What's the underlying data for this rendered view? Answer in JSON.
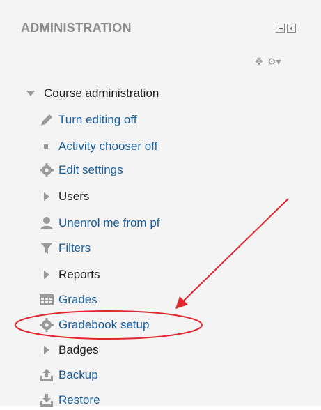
{
  "block": {
    "title": "ADMINISTRATION"
  },
  "tree": {
    "root_label": "Course administration",
    "items": [
      {
        "label": "Turn editing off",
        "icon": "pencil-icon",
        "link": true
      },
      {
        "label": "Activity chooser off",
        "icon": "bullet-icon",
        "link": true
      },
      {
        "label": "Edit settings",
        "icon": "gear-icon",
        "link": true
      },
      {
        "label": "Users",
        "icon": "expand-arrow-icon",
        "link": false
      },
      {
        "label": "Unenrol me from pf",
        "icon": "user-icon",
        "link": true
      },
      {
        "label": "Filters",
        "icon": "filter-icon",
        "link": true
      },
      {
        "label": "Reports",
        "icon": "expand-arrow-icon",
        "link": false
      },
      {
        "label": "Grades",
        "icon": "table-icon",
        "link": true
      },
      {
        "label": "Gradebook setup",
        "icon": "gear-icon",
        "link": true
      },
      {
        "label": "Badges",
        "icon": "expand-arrow-icon",
        "link": false
      },
      {
        "label": "Backup",
        "icon": "upload-icon",
        "link": true
      },
      {
        "label": "Restore",
        "icon": "download-icon",
        "link": true
      }
    ]
  },
  "colors": {
    "link": "#1a5e9e",
    "annotation": "#e0262e"
  }
}
